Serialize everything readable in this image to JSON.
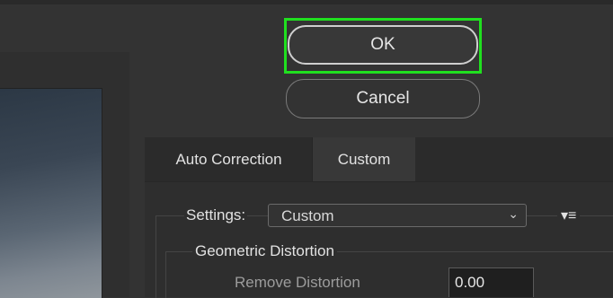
{
  "dialog": {
    "ok_label": "OK",
    "cancel_label": "Cancel"
  },
  "tabs": [
    {
      "label": "Auto Correction",
      "active": false
    },
    {
      "label": "Custom",
      "active": true
    }
  ],
  "settings": {
    "label": "Settings:",
    "selected": "Custom",
    "chevron_icon": "chevron-down-icon",
    "menu_icon": "panel-menu-icon",
    "menu_glyph": "▾≡"
  },
  "geometric_distortion": {
    "group_label": "Geometric Distortion",
    "remove_distortion_label": "Remove Distortion",
    "remove_distortion_value": "0.00"
  },
  "colors": {
    "focus_highlight": "#20e01f",
    "background": "#333333"
  }
}
